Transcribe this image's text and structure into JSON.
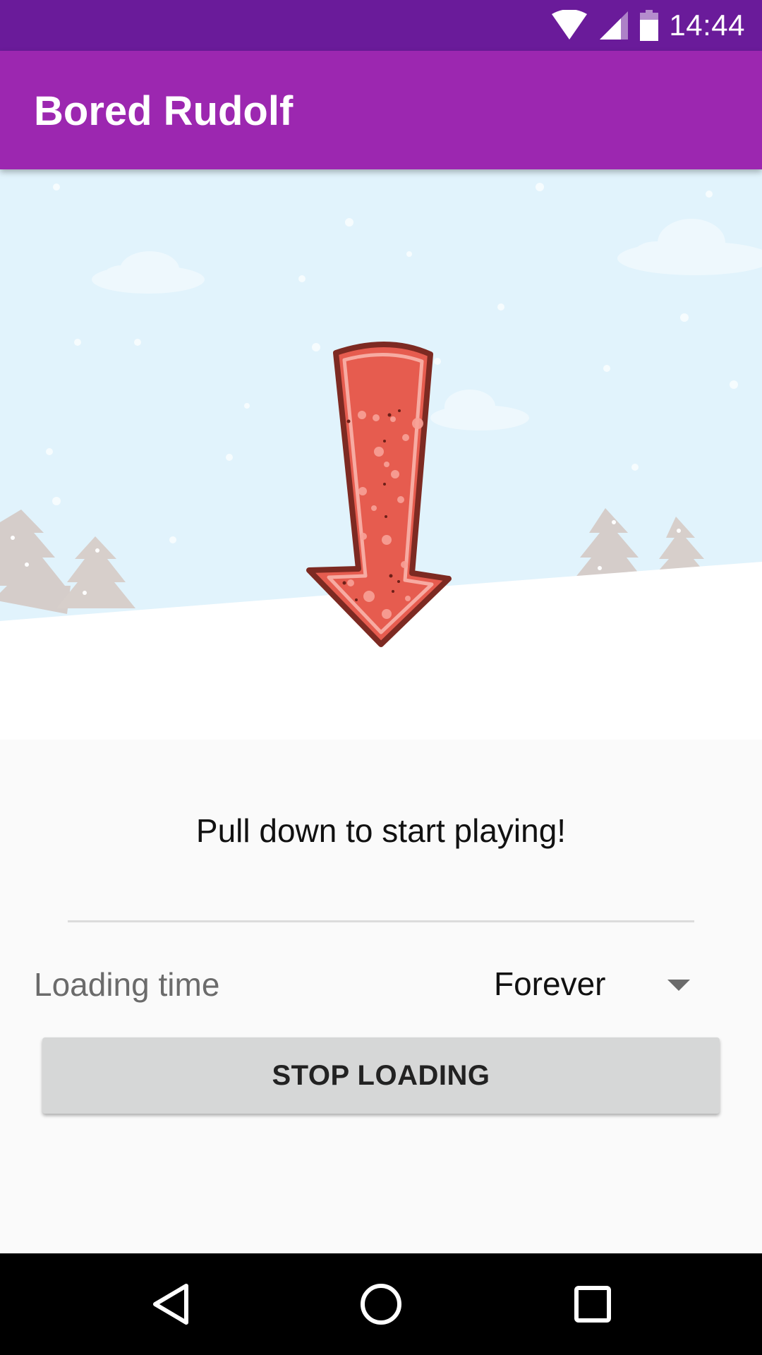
{
  "status_bar": {
    "time": "14:44",
    "icons": [
      "wifi-icon",
      "cell-signal-icon",
      "battery-icon"
    ]
  },
  "app_bar": {
    "title": "Bored Rudolf",
    "color": "#9c27b0"
  },
  "scene": {
    "sky_color": "#e1f3fc",
    "snow_color": "#ffffff",
    "arrow": "down-arrow-icon"
  },
  "main": {
    "instruction": "Pull down to start playing!",
    "loading_time_label": "Loading time",
    "loading_time_value": "Forever",
    "stop_button_label": "STOP LOADING"
  },
  "nav_bar": {
    "items": [
      "back-icon",
      "home-icon",
      "recents-icon"
    ]
  }
}
